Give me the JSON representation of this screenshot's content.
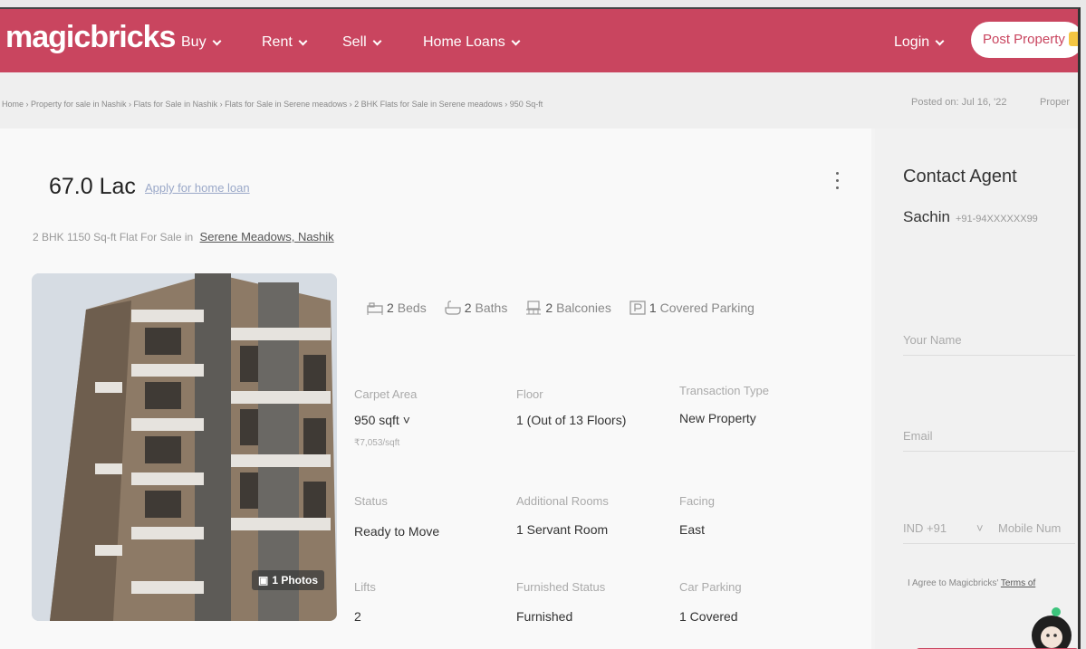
{
  "header": {
    "logo": "magicbricks",
    "nav": [
      "Buy",
      "Rent",
      "Sell",
      "Home Loans"
    ],
    "login": "Login",
    "post_property": "Post Property"
  },
  "breadcrumb": {
    "text": "Home › Property for sale in Nashik › Flats for Sale in Nashik › Flats for Sale in Serene meadows › 2 BHK Flats for Sale in Serene meadows › 950 Sq-ft",
    "posted": "Posted on: Jul 16, '22",
    "proper": "Proper"
  },
  "listing": {
    "price": "67.0 Lac",
    "loan_link": "Apply for home loan",
    "subtitle": "2 BHK 1150 Sq-ft Flat For Sale in",
    "location": "Serene Meadows, Nashik",
    "photo_count": "1 Photos"
  },
  "amenities": [
    {
      "num": "2",
      "label": "Beds",
      "icon": "bed-icon"
    },
    {
      "num": "2",
      "label": "Baths",
      "icon": "bath-icon"
    },
    {
      "num": "2",
      "label": "Balconies",
      "icon": "balcony-icon"
    },
    {
      "num": "1",
      "label": "Covered Parking",
      "icon": "parking-icon"
    }
  ],
  "details": [
    {
      "label": "Carpet Area",
      "value": "950 sqft",
      "sub": "₹7,053/sqft"
    },
    {
      "label": "Floor",
      "value": "1 (Out of 13 Floors)"
    },
    {
      "label": "Transaction Type",
      "value": "New Property"
    },
    {
      "label": "Status",
      "value": "Ready to Move"
    },
    {
      "label": "Additional Rooms",
      "value": "1 Servant Room"
    },
    {
      "label": "Facing",
      "value": "East"
    },
    {
      "label": "Lifts",
      "value": "2"
    },
    {
      "label": "Furnished Status",
      "value": "Furnished"
    },
    {
      "label": "Car Parking",
      "value": "1 Covered"
    }
  ],
  "contact": {
    "title": "Contact Agent",
    "agent_name": "Sachin",
    "agent_phone": "+91-94XXXXXX99",
    "name_label": "Your Name",
    "email_label": "Email",
    "country_code": "IND +91",
    "mobile_placeholder": "Mobile Num",
    "agree_text": "I Agree to Magicbricks'",
    "terms": "Terms of"
  },
  "colors": {
    "brand": "#c9455f"
  }
}
